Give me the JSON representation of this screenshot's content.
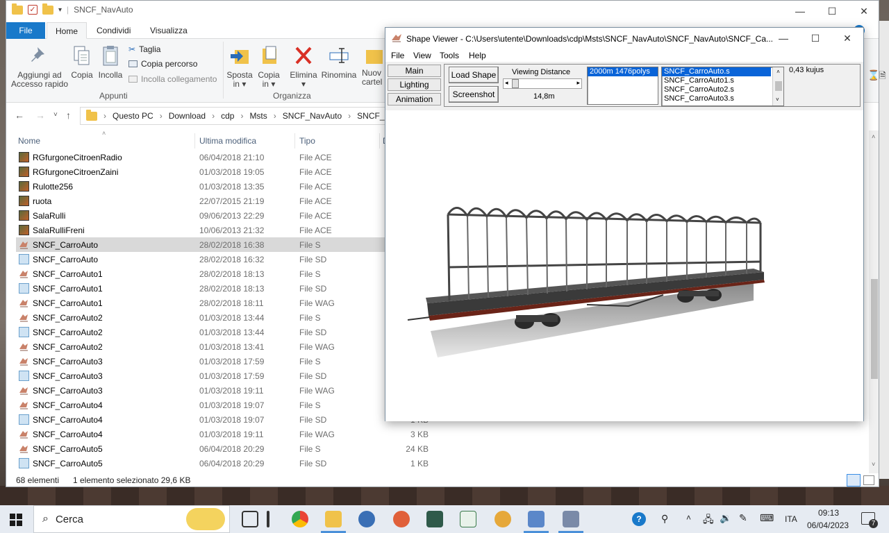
{
  "explorer": {
    "title": "SNCF_NavAuto",
    "tabs": [
      "File",
      "Home",
      "Condividi",
      "Visualizza"
    ],
    "ribbon": {
      "pin": {
        "line1": "Aggiungi ad",
        "line2": "Accesso rapido"
      },
      "copy": "Copia",
      "paste": "Incolla",
      "cut": "Taglia",
      "copy_path": "Copia percorso",
      "paste_link": "Incolla collegamento",
      "group_clipboard": "Appunti",
      "move": {
        "line1": "Sposta",
        "line2": "in ▾"
      },
      "copy_to": {
        "line1": "Copia",
        "line2": "in ▾"
      },
      "delete": {
        "line1": "Elimina",
        "line2": "▾"
      },
      "rename": "Rinomina",
      "new_folder": {
        "line1": "Nuov",
        "line2": "cartel"
      },
      "group_organize": "Organizza"
    },
    "breadcrumb": [
      "Questo PC",
      "Download",
      "cdp",
      "Msts",
      "SNCF_NavAuto",
      "SNCF_Na"
    ],
    "columns": {
      "name": "Nome",
      "modified": "Ultima modifica",
      "type": "Tipo",
      "size": "D"
    },
    "files": [
      {
        "name": "RGfurgoneCitroenRadio",
        "date": "06/04/2018 21:10",
        "type": "File ACE",
        "size": "",
        "icon": "ace"
      },
      {
        "name": "RGfurgoneCitroenZaini",
        "date": "01/03/2018 19:05",
        "type": "File ACE",
        "size": "",
        "icon": "ace"
      },
      {
        "name": "Rulotte256",
        "date": "01/03/2018 13:35",
        "type": "File ACE",
        "size": "",
        "icon": "ace"
      },
      {
        "name": "ruota",
        "date": "22/07/2015 21:19",
        "type": "File ACE",
        "size": "",
        "icon": "ace"
      },
      {
        "name": "SalaRulli",
        "date": "09/06/2013 22:29",
        "type": "File ACE",
        "size": "",
        "icon": "ace"
      },
      {
        "name": "SalaRulliFreni",
        "date": "10/06/2013 21:32",
        "type": "File ACE",
        "size": "",
        "icon": "ace"
      },
      {
        "name": "SNCF_CarroAuto",
        "date": "28/02/2018 16:38",
        "type": "File S",
        "size": "",
        "icon": "s",
        "selected": true
      },
      {
        "name": "SNCF_CarroAuto",
        "date": "28/02/2018 16:32",
        "type": "File SD",
        "size": "",
        "icon": "sd"
      },
      {
        "name": "SNCF_CarroAuto1",
        "date": "28/02/2018 18:13",
        "type": "File S",
        "size": "",
        "icon": "s"
      },
      {
        "name": "SNCF_CarroAuto1",
        "date": "28/02/2018 18:13",
        "type": "File SD",
        "size": "",
        "icon": "sd"
      },
      {
        "name": "SNCF_CarroAuto1",
        "date": "28/02/2018 18:11",
        "type": "File WAG",
        "size": "",
        "icon": "s"
      },
      {
        "name": "SNCF_CarroAuto2",
        "date": "01/03/2018 13:44",
        "type": "File S",
        "size": "",
        "icon": "s"
      },
      {
        "name": "SNCF_CarroAuto2",
        "date": "01/03/2018 13:44",
        "type": "File SD",
        "size": "",
        "icon": "sd"
      },
      {
        "name": "SNCF_CarroAuto2",
        "date": "01/03/2018 13:41",
        "type": "File WAG",
        "size": "",
        "icon": "s"
      },
      {
        "name": "SNCF_CarroAuto3",
        "date": "01/03/2018 17:59",
        "type": "File S",
        "size": "",
        "icon": "s"
      },
      {
        "name": "SNCF_CarroAuto3",
        "date": "01/03/2018 17:59",
        "type": "File SD",
        "size": "",
        "icon": "sd"
      },
      {
        "name": "SNCF_CarroAuto3",
        "date": "01/03/2018 19:11",
        "type": "File WAG",
        "size": "",
        "icon": "s"
      },
      {
        "name": "SNCF_CarroAuto4",
        "date": "01/03/2018 19:07",
        "type": "File S",
        "size": "",
        "icon": "s"
      },
      {
        "name": "SNCF_CarroAuto4",
        "date": "01/03/2018 19:07",
        "type": "File SD",
        "size": "1 KB",
        "icon": "sd"
      },
      {
        "name": "SNCF_CarroAuto4",
        "date": "01/03/2018 19:11",
        "type": "File WAG",
        "size": "3 KB",
        "icon": "s"
      },
      {
        "name": "SNCF_CarroAuto5",
        "date": "06/04/2018 20:29",
        "type": "File S",
        "size": "24 KB",
        "icon": "s"
      },
      {
        "name": "SNCF_CarroAuto5",
        "date": "06/04/2018 20:29",
        "type": "File SD",
        "size": "1 KB",
        "icon": "sd"
      }
    ],
    "status": {
      "count": "68 elementi",
      "selected": "1 elemento selezionato  29,6 KB"
    }
  },
  "viewer": {
    "title": "Shape Viewer - C:\\Users\\utente\\Downloads\\cdp\\Msts\\SNCF_NavAuto\\SNCF_NavAuto\\SNCF_Ca...",
    "menu": [
      "File",
      "View",
      "Tools",
      "Help"
    ],
    "side_buttons": [
      "Main",
      "Lighting",
      "Animation"
    ],
    "load_shape": "Load Shape",
    "screenshot": "Screenshot",
    "viewing_distance_label": "Viewing Distance",
    "viewing_distance_value": "14,8m",
    "lod_items": [
      "2000m 1476polys"
    ],
    "shape_items": [
      "SNCF_CarroAuto.s",
      "SNCF_CarroAuto1.s",
      "SNCF_CarroAuto2.s",
      "SNCF_CarroAuto3.s"
    ],
    "kujus": "0,43 kujus"
  },
  "taskbar": {
    "search": "Cerca",
    "lang": "ITA",
    "time": "09:13",
    "date": "06/04/2023",
    "notif_count": "7"
  },
  "colors": {
    "accent": "#1979ca",
    "selection": "#0a64d8",
    "delete_red": "#d93025"
  }
}
